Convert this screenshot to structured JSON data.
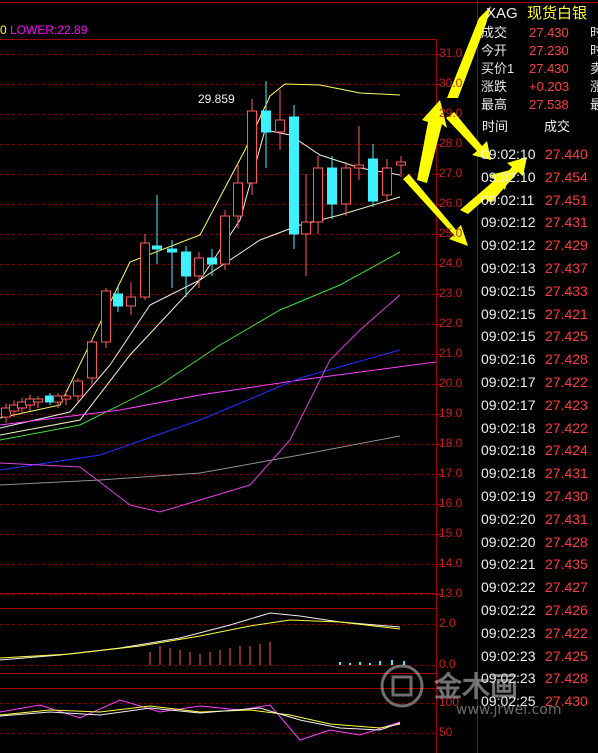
{
  "indicator_top": {
    "left_fragment": "0",
    "lower_label": "LOWER:22.89",
    "color": "#ff00ff"
  },
  "main_chart": {
    "y_ticks": [
      "31.0",
      "30.0",
      "29.0",
      "28.0",
      "27.0",
      "26.0",
      "25.0",
      "24.0",
      "23.0",
      "22.0",
      "21.0",
      "20.0",
      "19.0",
      "18.0",
      "17.0",
      "16.0",
      "15.0",
      "14.0",
      "13.0"
    ],
    "peak_label": "29.859"
  },
  "macd_panel": {
    "y_ticks": [
      "2.0",
      "0.0"
    ]
  },
  "kdj_panel": {
    "y_ticks": [
      "100",
      "50"
    ]
  },
  "quote": {
    "symbol": "XAG",
    "name": "现货白银",
    "rows": [
      {
        "label": "成交",
        "value": "27.430",
        "side": "时"
      },
      {
        "label": "今开",
        "value": "27.230",
        "side": "时"
      },
      {
        "label": "买价1",
        "value": "27.430",
        "side": "卖"
      },
      {
        "label": "涨跌",
        "value": "+0.203",
        "side": "涨"
      },
      {
        "label": "最高",
        "value": "27.538",
        "side": "最"
      }
    ]
  },
  "ticks_table": {
    "headers": {
      "time": "时间",
      "price": "成交"
    },
    "rows": [
      {
        "time": "09:02:10",
        "price": "27.440"
      },
      {
        "time": "09:02:10",
        "price": "27.454"
      },
      {
        "time": "09:02:11",
        "price": "27.451"
      },
      {
        "time": "09:02:12",
        "price": "27.431"
      },
      {
        "time": "09:02:12",
        "price": "27.429"
      },
      {
        "time": "09:02:13",
        "price": "27.437"
      },
      {
        "time": "09:02:15",
        "price": "27.433"
      },
      {
        "time": "09:02:15",
        "price": "27.421"
      },
      {
        "time": "09:02:15",
        "price": "27.425"
      },
      {
        "time": "09:02:16",
        "price": "27.428"
      },
      {
        "time": "09:02:17",
        "price": "27.422"
      },
      {
        "time": "09:02:17",
        "price": "27.423"
      },
      {
        "time": "09:02:18",
        "price": "27.422"
      },
      {
        "time": "09:02:18",
        "price": "27.424"
      },
      {
        "time": "09:02:18",
        "price": "27.431"
      },
      {
        "time": "09:02:19",
        "price": "27.430"
      },
      {
        "time": "09:02:20",
        "price": "27.431"
      },
      {
        "time": "09:02:20",
        "price": "27.428"
      },
      {
        "time": "09:02:21",
        "price": "27.435"
      },
      {
        "time": "09:02:22",
        "price": "27.427"
      },
      {
        "time": "09:02:22",
        "price": "27.426"
      },
      {
        "time": "09:02:23",
        "price": "27.422"
      },
      {
        "time": "09:02:23",
        "price": "27.425"
      },
      {
        "time": "09:02:23",
        "price": "27.428"
      },
      {
        "time": "09:02:25",
        "price": "27.430"
      }
    ]
  },
  "watermark": {
    "brand": "金木画",
    "url": "www.jrwei.com"
  },
  "colors": {
    "grid": "#8b0000",
    "up": "#ff5a5a",
    "down": "#3ff0ff",
    "annotation": "#ffff00"
  }
}
